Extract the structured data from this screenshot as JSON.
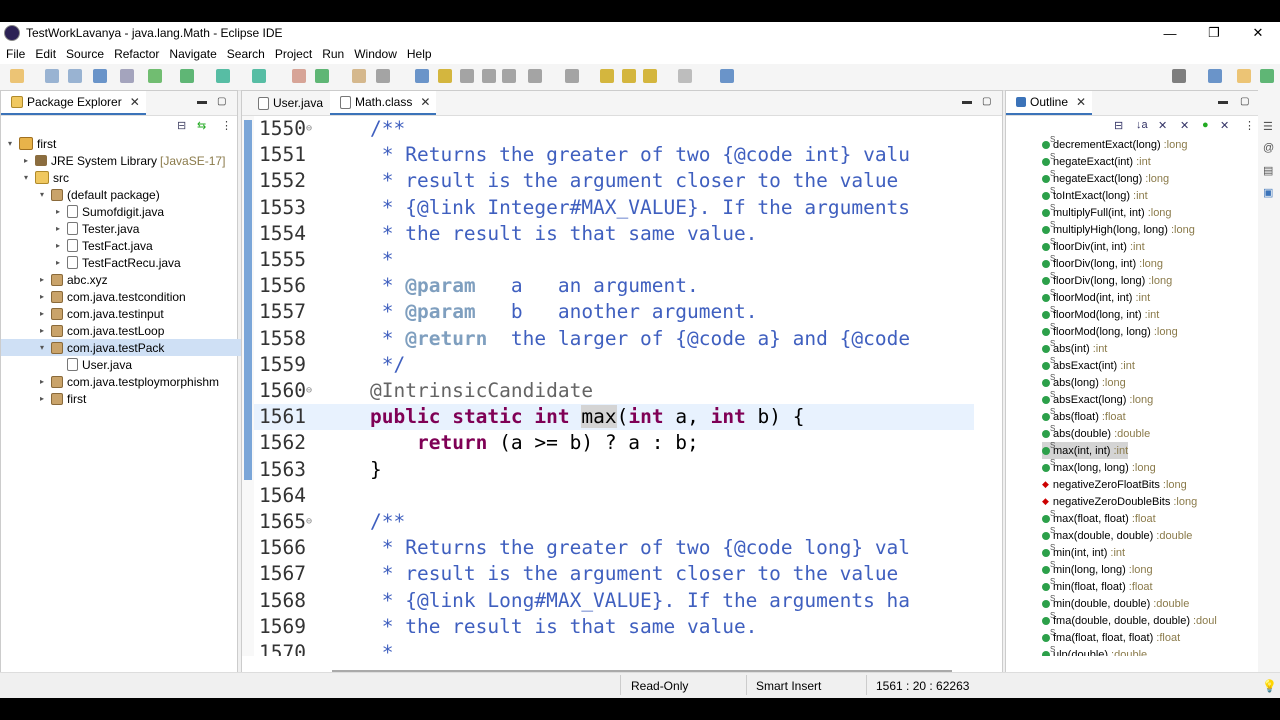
{
  "window": {
    "title": "TestWorkLavanya - java.lang.Math - Eclipse IDE"
  },
  "menu": [
    "File",
    "Edit",
    "Source",
    "Refactor",
    "Navigate",
    "Search",
    "Project",
    "Run",
    "Window",
    "Help"
  ],
  "package_explorer": {
    "tab": "Package Explorer",
    "items": [
      {
        "label": "first",
        "extra": "",
        "indent": 0,
        "arrow": "v",
        "icon": "proj"
      },
      {
        "label": "JRE System Library",
        "extra": "[JavaSE-17]",
        "indent": 1,
        "arrow": ">",
        "icon": "lib"
      },
      {
        "label": "src",
        "extra": "",
        "indent": 1,
        "arrow": "v",
        "icon": "folder"
      },
      {
        "label": "(default package)",
        "extra": "",
        "indent": 2,
        "arrow": "v",
        "icon": "pkg"
      },
      {
        "label": "Sumofdigit.java",
        "extra": "",
        "indent": 3,
        "arrow": ">",
        "icon": "java"
      },
      {
        "label": "Tester.java",
        "extra": "",
        "indent": 3,
        "arrow": ">",
        "icon": "java"
      },
      {
        "label": "TestFact.java",
        "extra": "",
        "indent": 3,
        "arrow": ">",
        "icon": "java"
      },
      {
        "label": "TestFactRecu.java",
        "extra": "",
        "indent": 3,
        "arrow": ">",
        "icon": "java"
      },
      {
        "label": "abc.xyz",
        "extra": "",
        "indent": 2,
        "arrow": ">",
        "icon": "pkg"
      },
      {
        "label": "com.java.testcondition",
        "extra": "",
        "indent": 2,
        "arrow": ">",
        "icon": "pkg"
      },
      {
        "label": "com.java.testinput",
        "extra": "",
        "indent": 2,
        "arrow": ">",
        "icon": "pkg"
      },
      {
        "label": "com.java.testLoop",
        "extra": "",
        "indent": 2,
        "arrow": ">",
        "icon": "pkg"
      },
      {
        "label": "com.java.testPack",
        "extra": "",
        "indent": 2,
        "arrow": "v",
        "icon": "pkg",
        "selected": true
      },
      {
        "label": "User.java",
        "extra": "",
        "indent": 3,
        "arrow": "",
        "icon": "java"
      },
      {
        "label": "com.java.testploymorphishm",
        "extra": "",
        "indent": 2,
        "arrow": ">",
        "icon": "pkg"
      },
      {
        "label": "first",
        "extra": "",
        "indent": 2,
        "arrow": ">",
        "icon": "pkg"
      }
    ]
  },
  "editor": {
    "tabs": [
      "User.java",
      "Math.class"
    ],
    "active_tab": "Math.class",
    "lines": [
      {
        "n": "1550",
        "fold": true,
        "html": "<span class='cm'>/**</span>",
        "ind": 0
      },
      {
        "n": "1551",
        "html": "<span class='cm'> * Returns the greater of two {@code int} valu</span>",
        "ind": 0
      },
      {
        "n": "1552",
        "html": "<span class='cm'> * result is the argument closer to the value</span>",
        "ind": 0
      },
      {
        "n": "1553",
        "html": "<span class='cm'> * {@link Integer#MAX_VALUE}. If the arguments</span>",
        "ind": 0
      },
      {
        "n": "1554",
        "html": "<span class='cm'> * the result is that same value.</span>",
        "ind": 0
      },
      {
        "n": "1555",
        "html": "<span class='cm'> *</span>",
        "ind": 0
      },
      {
        "n": "1556",
        "html": "<span class='cm'> * </span><span class='tag'>@param</span><span class='cm'>   a   an argument.</span>",
        "ind": 0
      },
      {
        "n": "1557",
        "html": "<span class='cm'> * </span><span class='tag'>@param</span><span class='cm'>   b   another argument.</span>",
        "ind": 0
      },
      {
        "n": "1558",
        "html": "<span class='cm'> * </span><span class='tag'>@return</span><span class='cm'>  the larger of {@code a} and {@code</span>",
        "ind": 0
      },
      {
        "n": "1559",
        "html": "<span class='cm'> */</span>",
        "ind": 0
      },
      {
        "n": "1560",
        "fold": true,
        "html": "<span class='ann'>@IntrinsicCandidate</span>",
        "ind": 0
      },
      {
        "n": "1561",
        "cur": true,
        "html": "<span class='kw'>public</span> <span class='kw'>static</span> <span class='kw'>int</span> <span class='hl'>max</span>(<span class='kw'>int</span> a, <span class='kw'>int</span> b) {",
        "ind": 0
      },
      {
        "n": "1562",
        "html": "    <span class='kw'>return</span> (a &gt;= b) ? a : b;",
        "ind": 0
      },
      {
        "n": "1563",
        "html": "}",
        "ind": 0
      },
      {
        "n": "1564",
        "html": "",
        "ind": 0
      },
      {
        "n": "1565",
        "fold": true,
        "html": "<span class='cm'>/**</span>",
        "ind": 0
      },
      {
        "n": "1566",
        "html": "<span class='cm'> * Returns the greater of two {@code long} val</span>",
        "ind": 0
      },
      {
        "n": "1567",
        "html": "<span class='cm'> * result is the argument closer to the value</span>",
        "ind": 0
      },
      {
        "n": "1568",
        "html": "<span class='cm'> * {@link Long#MAX_VALUE}. If the arguments ha</span>",
        "ind": 0
      },
      {
        "n": "1569",
        "html": "<span class='cm'> * the result is that same value.</span>",
        "ind": 0
      },
      {
        "n": "1570",
        "html": "<span class='cm'> *</span>",
        "ind": 0
      }
    ]
  },
  "outline": {
    "tab": "Outline",
    "items": [
      {
        "name": "decrementExact(long)",
        "ret": "long"
      },
      {
        "name": "negateExact(int)",
        "ret": "int"
      },
      {
        "name": "negateExact(long)",
        "ret": "long"
      },
      {
        "name": "toIntExact(long)",
        "ret": "int"
      },
      {
        "name": "multiplyFull(int, int)",
        "ret": "long"
      },
      {
        "name": "multiplyHigh(long, long)",
        "ret": "long"
      },
      {
        "name": "floorDiv(int, int)",
        "ret": "int"
      },
      {
        "name": "floorDiv(long, int)",
        "ret": "long"
      },
      {
        "name": "floorDiv(long, long)",
        "ret": "long"
      },
      {
        "name": "floorMod(int, int)",
        "ret": "int"
      },
      {
        "name": "floorMod(long, int)",
        "ret": "int"
      },
      {
        "name": "floorMod(long, long)",
        "ret": "long"
      },
      {
        "name": "abs(int)",
        "ret": "int"
      },
      {
        "name": "absExact(int)",
        "ret": "int"
      },
      {
        "name": "abs(long)",
        "ret": "long"
      },
      {
        "name": "absExact(long)",
        "ret": "long"
      },
      {
        "name": "abs(float)",
        "ret": "float"
      },
      {
        "name": "abs(double)",
        "ret": "double"
      },
      {
        "name": "max(int, int)",
        "ret": "int",
        "selected": true
      },
      {
        "name": "max(long, long)",
        "ret": "long"
      },
      {
        "name": "negativeZeroFloatBits",
        "ret": "long",
        "field": true
      },
      {
        "name": "negativeZeroDoubleBits",
        "ret": "long",
        "field": true
      },
      {
        "name": "max(float, float)",
        "ret": "float"
      },
      {
        "name": "max(double, double)",
        "ret": "double"
      },
      {
        "name": "min(int, int)",
        "ret": "int"
      },
      {
        "name": "min(long, long)",
        "ret": "long"
      },
      {
        "name": "min(float, float)",
        "ret": "float"
      },
      {
        "name": "min(double, double)",
        "ret": "double"
      },
      {
        "name": "fma(double, double, double)",
        "ret": "doul"
      },
      {
        "name": "fma(float, float, float)",
        "ret": "float"
      },
      {
        "name": "ulp(double)",
        "ret": "double"
      }
    ]
  },
  "status": {
    "mode": "Read-Only",
    "insert": "Smart Insert",
    "position": "1561 : 20 : 62263"
  }
}
